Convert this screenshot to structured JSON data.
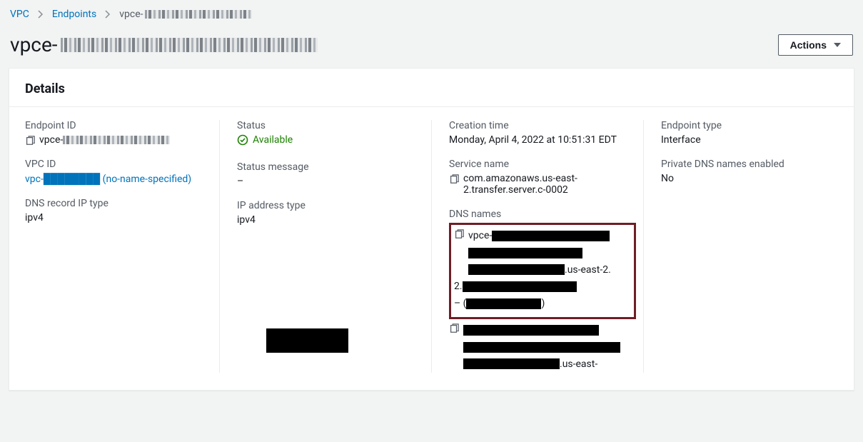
{
  "breadcrumb": {
    "vpc": "VPC",
    "endpoints": "Endpoints",
    "current_prefix": "vpce-"
  },
  "title_prefix": "vpce-",
  "actions_label": "Actions",
  "panel": {
    "heading": "Details",
    "col1": {
      "endpoint_id_label": "Endpoint ID",
      "endpoint_id_prefix": "vpce-",
      "vpc_id_label": "VPC ID",
      "vpc_id_link": "vpc-████████ (no-name-specified)",
      "dns_record_ip_type_label": "DNS record IP type",
      "dns_record_ip_type_value": "ipv4"
    },
    "col2": {
      "status_label": "Status",
      "status_value": "Available",
      "status_message_label": "Status message",
      "status_message_value": "–",
      "ip_address_type_label": "IP address type",
      "ip_address_type_value": "ipv4"
    },
    "col3": {
      "creation_time_label": "Creation time",
      "creation_time_value": "Monday, April 4, 2022 at 10:51:31 EDT",
      "service_name_label": "Service name",
      "service_name_value": "com.amazonaws.us-east-2.transfer.server.c-0002",
      "dns_names_label": "DNS names",
      "dns_name1_prefix": "vpce-",
      "dns_name1_suffix": ".us-east-2.",
      "dns_name1_trail": "– (",
      "dns_name1_close": ")",
      "dns_name2_suffix": ".us-east-"
    },
    "col4": {
      "endpoint_type_label": "Endpoint type",
      "endpoint_type_value": "Interface",
      "private_dns_enabled_label": "Private DNS names enabled",
      "private_dns_enabled_value": "No"
    }
  }
}
